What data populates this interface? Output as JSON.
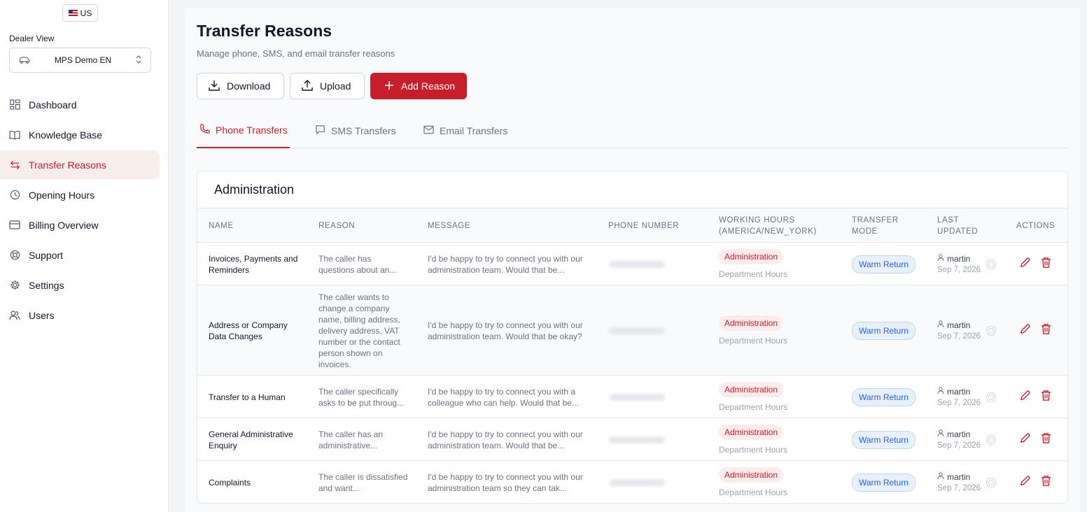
{
  "sidebar": {
    "lang": "US",
    "dealer_label": "Dealer View",
    "dealer_name": "MPS Demo EN",
    "items": [
      {
        "label": "Dashboard",
        "icon": "dashboard-icon"
      },
      {
        "label": "Knowledge Base",
        "icon": "book-icon"
      },
      {
        "label": "Transfer Reasons",
        "icon": "transfer-icon",
        "active": true
      },
      {
        "label": "Opening Hours",
        "icon": "clock-icon"
      },
      {
        "label": "Billing Overview",
        "icon": "credit-card-icon"
      },
      {
        "label": "Support",
        "icon": "lifebuoy-icon"
      },
      {
        "label": "Settings",
        "icon": "gear-icon"
      },
      {
        "label": "Users",
        "icon": "users-icon"
      }
    ]
  },
  "page": {
    "title": "Transfer Reasons",
    "subtitle": "Manage phone, SMS, and email transfer reasons",
    "buttons": {
      "download": "Download",
      "upload": "Upload",
      "add": "Add Reason"
    },
    "tabs": [
      "Phone Transfers",
      "SMS Transfers",
      "Email Transfers"
    ]
  },
  "card": {
    "title": "Administration",
    "headers": {
      "name": "NAME",
      "reason": "REASON",
      "message": "MESSAGE",
      "phone": "PHONE NUMBER",
      "hours_1": "WORKING HOURS",
      "hours_2": "(AMERICA/NEW_YORK)",
      "mode_1": "TRANSFER",
      "mode_2": "MODE",
      "upd_1": "LAST",
      "upd_2": "UPDATED",
      "actions": "ACTIONS"
    },
    "rows": [
      {
        "name": "Invoices, Payments and Reminders",
        "reason": "The caller has questions about an...",
        "message": "I'd be happy to try to connect you with our administration team. Would that be...",
        "dept": "Administration",
        "hours": "Department Hours",
        "mode": "Warm Return",
        "user": "martin",
        "date": "Sep 7, 2026"
      },
      {
        "name": "Address or Company Data Changes",
        "reason": "The caller wants to change a company name, billing address, delivery address, VAT number or the contact person shown on invoices.",
        "message": "I'd be happy to try to connect you with our administration team. Would that be okay?",
        "dept": "Administration",
        "hours": "Department Hours",
        "mode": "Warm Return",
        "user": "martin",
        "date": "Sep 7, 2026"
      },
      {
        "name": "Transfer to a Human",
        "reason": "The caller specifically asks to be put throug...",
        "message": "I'd be happy to try to connect you with a colleague who can help. Would that be...",
        "dept": "Administration",
        "hours": "Department Hours",
        "mode": "Warm Return",
        "user": "martin",
        "date": "Sep 7, 2026"
      },
      {
        "name": "General Administrative Enquiry",
        "reason": "The caller has an administrative...",
        "message": "I'd be happy to try to connect you with our administration team. Would that be...",
        "dept": "Administration",
        "hours": "Department Hours",
        "mode": "Warm Return",
        "user": "martin",
        "date": "Sep 7, 2026"
      },
      {
        "name": "Complaints",
        "reason": "The caller is dissatisfied and want...",
        "message": "I'd be happy to try to connect you with our administration team so they can tak...",
        "dept": "Administration",
        "hours": "Department Hours",
        "mode": "Warm Return",
        "user": "martin",
        "date": "Sep 7, 2026"
      }
    ]
  },
  "colors": {
    "accent": "#c81e2b",
    "warm_badge": "#2563eb"
  }
}
